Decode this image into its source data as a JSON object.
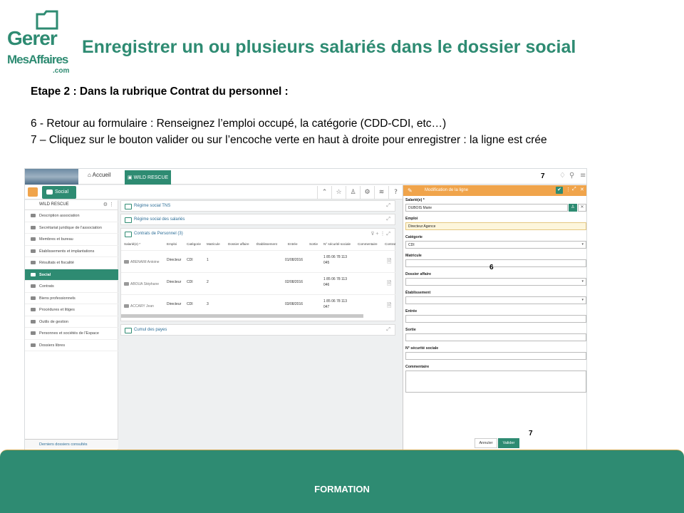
{
  "logo": {
    "line1": "Gerer",
    "line2": "MesAffaires",
    "line3": ".com"
  },
  "title": "Enregistrer un ou plusieurs salariés dans le dossier social",
  "step": "Etape 2 : Dans la rubrique Contrat du personnel :",
  "instructions": [
    "6 -  Retour au formulaire : Renseignez l’emploi occupé, la catégorie (CDD-CDI, etc…)",
    "7 – Cliquez sur le bouton valider ou sur l’encoche verte en haut à droite pour enregistrer : la ligne est crée"
  ],
  "app": {
    "tabs": {
      "home": "Accueil",
      "org": "WILD RESCUE"
    },
    "callout_top": "7",
    "section_tab": "Social",
    "sidebar": {
      "header": "WILD RESCUE",
      "items": [
        "Description association",
        "Secrétariat juridique de l'association",
        "Membres et bureau",
        "Établissements et implantations",
        "Résultats et fiscalité",
        "Social",
        "Contrats",
        "Biens professionnels",
        "Procédures et litiges",
        "Outils de gestion",
        "Personnes et sociétés de l'Espace",
        "Dossiers libres"
      ],
      "footer": "Derniers dossiers consultés"
    },
    "panels": {
      "tns": "Régime social TNS",
      "salaries": "Régime social des salariés",
      "contrats": "Contrats de Personnel (3)",
      "cumul": "Cumul des payes"
    },
    "table": {
      "columns": [
        "Salarié(e) *",
        "Emploi",
        "Catégorie",
        "Matricule",
        "Dossier affaire",
        "Établissement",
        "Entrée",
        "Sortie",
        "N° sécurité sociale",
        "Commentaire",
        "Contrat"
      ],
      "rows": [
        {
          "name": "ABENAIM Antoine",
          "emploi": "Directeur",
          "cat": "CDI",
          "mat": "1",
          "entree": "01/08/2016",
          "ss1": "1 85 06 78 113",
          "ss2": "045"
        },
        {
          "name": "ABOUA Stéphane",
          "emploi": "Directeur",
          "cat": "CDI",
          "mat": "2",
          "entree": "02/08/2016",
          "ss1": "1 85 06 78 113",
          "ss2": "046"
        },
        {
          "name": "ACCARY Jean",
          "emploi": "Directeur",
          "cat": "CDI",
          "mat": "3",
          "entree": "03/08/2016",
          "ss1": "1 85 06 78 113",
          "ss2": "047"
        }
      ]
    },
    "form": {
      "header": "Modification de la ligne",
      "fields": {
        "salarie_label": "Salarié(e) *",
        "salarie_value": "DUBOIS Marie",
        "emploi_label": "Emploi",
        "emploi_value": "Directeur Agence",
        "categorie_label": "Catégorie",
        "categorie_value": "CDI",
        "matricule_label": "Matricule",
        "dossier_label": "Dossier affaire",
        "etab_label": "Établissement",
        "entree_label": "Entrée",
        "sortie_label": "Sortie",
        "ss_label": "N° sécurité sociale",
        "commentaire_label": "Commentaire"
      },
      "callout_mid": "6",
      "callout_bottom": "7",
      "cancel": "Annuler",
      "submit": "Valider"
    }
  },
  "footer": "FORMATION"
}
